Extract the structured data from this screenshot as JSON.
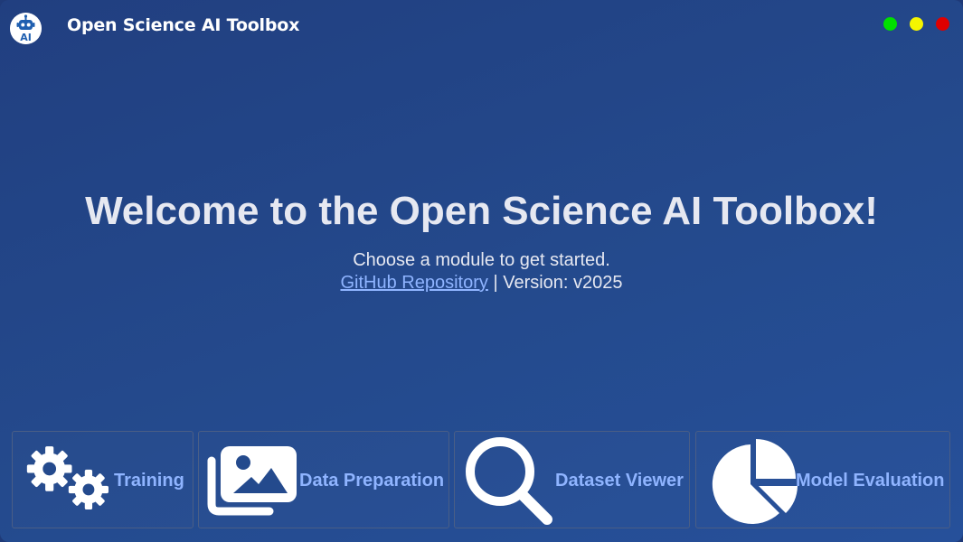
{
  "window": {
    "title": "Open Science AI Toolbox",
    "logo_icon": "robot-ai-icon",
    "controls": [
      {
        "name": "maximize",
        "color": "#00e000"
      },
      {
        "name": "minimize",
        "color": "#f5f500"
      },
      {
        "name": "close",
        "color": "#e00000"
      }
    ]
  },
  "hero": {
    "heading": "Welcome to the Open Science AI Toolbox!",
    "subtitle": "Choose a module to get started.",
    "link_text": "GitHub Repository",
    "separator": "|",
    "version_text": "Version: v2025"
  },
  "modules": [
    {
      "label": "Training",
      "icon": "gears-icon"
    },
    {
      "label": "Data Preparation",
      "icon": "images-icon"
    },
    {
      "label": "Dataset Viewer",
      "icon": "magnifier-icon"
    },
    {
      "label": "Model Evaluation",
      "icon": "pie-chart-icon"
    }
  ],
  "colors": {
    "background": "#244a8d",
    "accent_text": "#8fb4ff",
    "heading_text": "#e6e8f1"
  }
}
